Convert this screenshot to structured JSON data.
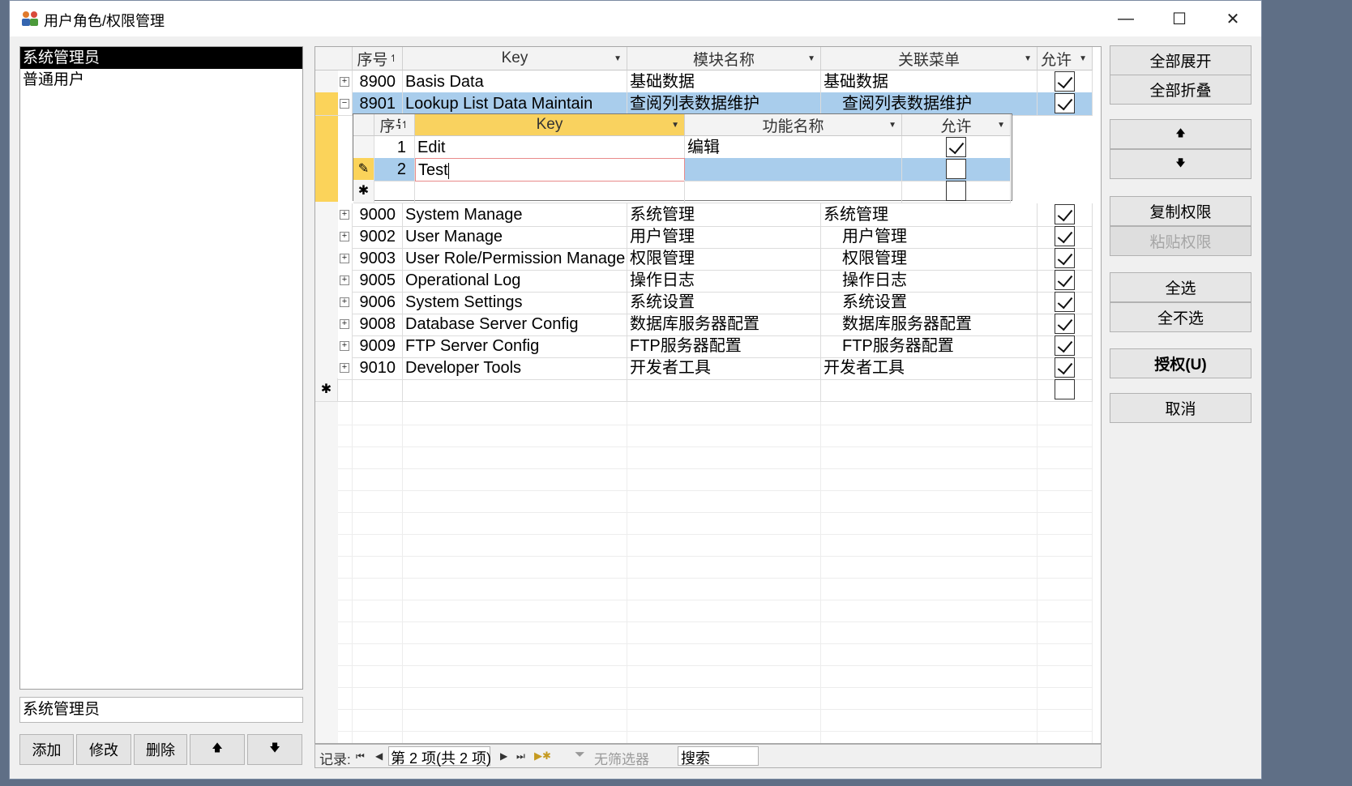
{
  "window": {
    "title": "用户角色/权限管理",
    "minimize_glyph": "—",
    "maximize_glyph": "☐",
    "close_glyph": "✕"
  },
  "roles": {
    "items": [
      "系统管理员",
      "普通用户"
    ],
    "selected": "系统管理员",
    "name_field_value": "系统管理员",
    "buttons": {
      "add": "添加",
      "edit": "修改",
      "delete": "删除",
      "up": "🡅",
      "down": "🡇"
    }
  },
  "grid": {
    "headers": {
      "seq": "序号",
      "key": "Key",
      "module": "模块名称",
      "menu": "关联菜单",
      "allow": "允许"
    },
    "rows": [
      {
        "seq": "8900",
        "key": "Basis Data",
        "module": "基础数据",
        "menu": "基础数据",
        "allow": true,
        "expander": "+"
      },
      {
        "seq": "8901",
        "key": "Lookup List Data Maintain",
        "module": "查阅列表数据维护",
        "menu": "查阅列表数据维护",
        "allow": true,
        "expander": "−"
      },
      {
        "seq": "9000",
        "key": "System Manage",
        "module": "系统管理",
        "menu": "系统管理",
        "allow": true,
        "expander": "+"
      },
      {
        "seq": "9002",
        "key": "User Manage",
        "module": "用户管理",
        "menu": "用户管理",
        "allow": true,
        "expander": "+"
      },
      {
        "seq": "9003",
        "key": "User Role/Permission Manage",
        "module": "权限管理",
        "menu": "权限管理",
        "allow": true,
        "expander": "+"
      },
      {
        "seq": "9005",
        "key": "Operational Log",
        "module": "操作日志",
        "menu": "操作日志",
        "allow": true,
        "expander": "+"
      },
      {
        "seq": "9006",
        "key": "System Settings",
        "module": "系统设置",
        "menu": "系统设置",
        "allow": true,
        "expander": "+"
      },
      {
        "seq": "9008",
        "key": "Database Server Config",
        "module": "数据库服务器配置",
        "menu": "数据库服务器配置",
        "allow": true,
        "expander": "+"
      },
      {
        "seq": "9009",
        "key": "FTP Server Config",
        "module": "FTP服务器配置",
        "menu": "FTP服务器配置",
        "allow": true,
        "expander": "+"
      },
      {
        "seq": "9010",
        "key": "Developer Tools",
        "module": "开发者工具",
        "menu": "开发者工具",
        "allow": true,
        "expander": "+"
      }
    ],
    "new_row_marker": "✱"
  },
  "subgrid": {
    "headers": {
      "seq": "序号",
      "key": "Key",
      "func": "功能名称",
      "allow": "允许"
    },
    "rows": [
      {
        "seq": "1",
        "key": "Edit",
        "func": "编辑",
        "allow": true
      },
      {
        "seq": "2",
        "key": "Test",
        "func": "",
        "allow": false
      }
    ],
    "editing_marker": "✎",
    "new_row_marker": "✱"
  },
  "navigator": {
    "record_label": "记录:",
    "position": "第 2 项(共 2 项)",
    "filter_label": "无筛选器",
    "search_placeholder": "搜索"
  },
  "actions": {
    "expand_all": "全部展开",
    "collapse_all": "全部折叠",
    "move_up": "🡅",
    "move_down": "🡇",
    "copy_perm": "复制权限",
    "paste_perm": "粘贴权限",
    "select_all": "全选",
    "select_none": "全不选",
    "authorize": "授权(U)",
    "cancel": "取消"
  },
  "colors": {
    "selected_row": "#a9cdec",
    "current_header": "#f9d25f",
    "detail_bar": "#fbd35a"
  }
}
